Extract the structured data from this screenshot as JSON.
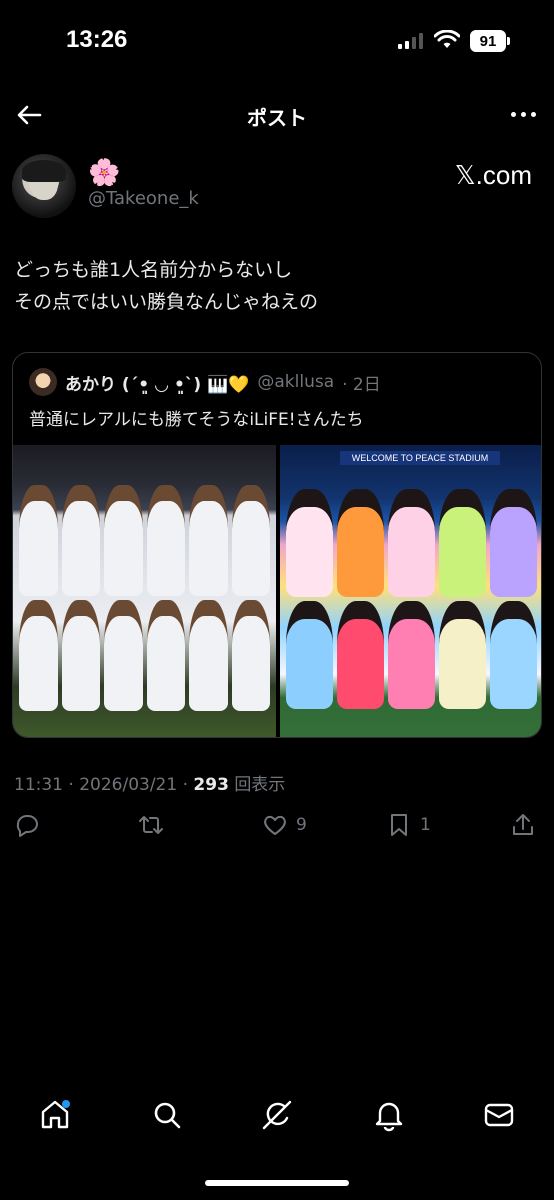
{
  "status_bar": {
    "time": "13:26",
    "battery": "91"
  },
  "header": {
    "title": "ポスト"
  },
  "author": {
    "display_name": "🌸",
    "handle": "@Takeone_k",
    "source_label": "𝕏.com"
  },
  "post": {
    "lines": [
      "どっちも誰1人名前分からないし",
      "その点ではいい勝負なんじゃねえの"
    ]
  },
  "quote": {
    "name": "あかり (ˊ•͈ ◡ •͈ˋ) 🎹💛",
    "handle": "@akllusa",
    "age": "· 2日",
    "text": "普通にレアルにも勝てそうなiLiFE!さんたち",
    "right_banner": "WELCOME TO PEACE STADIUM"
  },
  "meta": {
    "timestamp": "11:31 · 2026/03/21 ·",
    "views_count": "293",
    "views_label": "回表示"
  },
  "actions": {
    "likes": "9",
    "bookmarks": "1"
  },
  "colors": {
    "background": "#000000",
    "text": "#e7e9ea",
    "muted": "#71767b",
    "accent": "#1d9bf0"
  },
  "icons": [
    "back-arrow-icon",
    "more-icon",
    "reply-icon",
    "repost-icon",
    "like-icon",
    "bookmark-icon",
    "share-icon",
    "home-icon",
    "search-icon",
    "grok-icon",
    "notifications-icon",
    "messages-icon"
  ]
}
